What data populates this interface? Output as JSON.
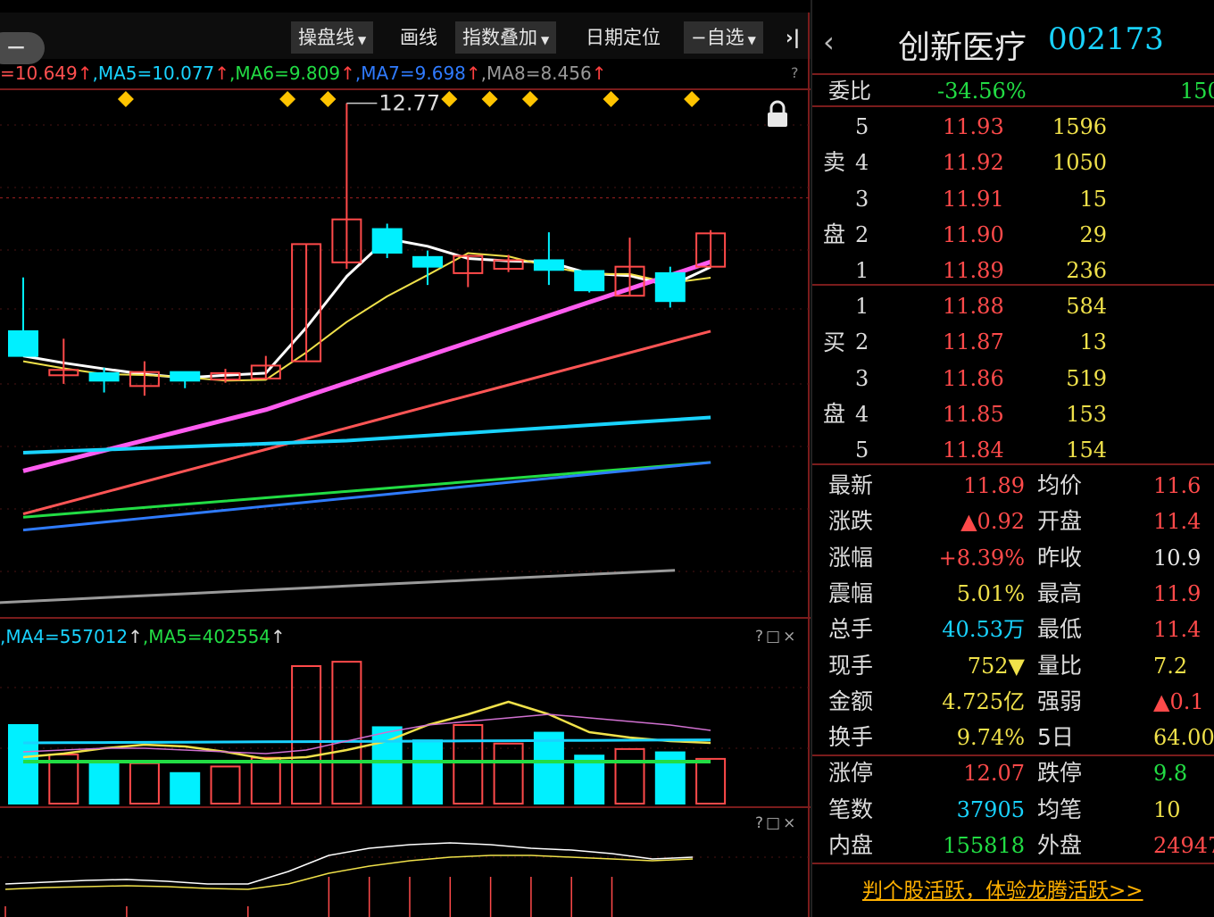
{
  "toolbar": {
    "minus": "−",
    "items": [
      {
        "label": "操盘线",
        "dropdown": true
      },
      {
        "label": "画线",
        "dropdown": false
      },
      {
        "label": "指数叠加",
        "dropdown": true
      },
      {
        "label": "日期定位",
        "dropdown": false
      },
      {
        "label": "−自选",
        "dropdown": true
      },
      {
        "label": "›|",
        "dropdown": false
      }
    ]
  },
  "main_chart": {
    "ma_legend": [
      {
        "text": "=10.649",
        "color": "#ff5050"
      },
      {
        "text": ",MA5=10.077",
        "color": "#19d3ff"
      },
      {
        "text": ",MA6=9.809",
        "color": "#22dd44"
      },
      {
        "text": ",MA7=9.698",
        "color": "#2f7bff"
      },
      {
        "text": ",MA8=8.456",
        "color": "#999999"
      }
    ],
    "high_label": "12.77",
    "help": "?"
  },
  "volume_pane": {
    "legend": [
      {
        "text": ",MA4=557012",
        "color": "#19d3ff"
      },
      {
        "text": ",MA5=402554",
        "color": "#22dd44"
      }
    ],
    "controls": "?□×"
  },
  "indicator_pane": {
    "controls": "?□×"
  },
  "chart_data": {
    "type": "candlestick",
    "candles": [
      {
        "open": 10.65,
        "close": 10.42,
        "high": 11.15,
        "low": 10.42
      },
      {
        "open": 10.24,
        "close": 10.29,
        "high": 10.58,
        "low": 10.16
      },
      {
        "open": 10.26,
        "close": 10.19,
        "high": 10.31,
        "low": 10.08
      },
      {
        "open": 10.14,
        "close": 10.27,
        "high": 10.37,
        "low": 10.05
      },
      {
        "open": 10.27,
        "close": 10.19,
        "high": 10.27,
        "low": 10.12
      },
      {
        "open": 10.2,
        "close": 10.26,
        "high": 10.3,
        "low": 10.17
      },
      {
        "open": 10.21,
        "close": 10.33,
        "high": 10.42,
        "low": 10.2
      },
      {
        "open": 10.37,
        "close": 11.46,
        "high": 11.46,
        "low": 10.37
      },
      {
        "open": 11.29,
        "close": 11.69,
        "high": 12.77,
        "low": 11.23
      },
      {
        "open": 11.6,
        "close": 11.38,
        "high": 11.65,
        "low": 11.33
      },
      {
        "open": 11.34,
        "close": 11.25,
        "high": 11.4,
        "low": 11.08
      },
      {
        "open": 11.19,
        "close": 11.35,
        "high": 11.35,
        "low": 11.06
      },
      {
        "open": 11.23,
        "close": 11.31,
        "high": 11.36,
        "low": 11.2
      },
      {
        "open": 11.31,
        "close": 11.22,
        "high": 11.57,
        "low": 11.08
      },
      {
        "open": 11.21,
        "close": 11.03,
        "high": 11.21,
        "low": 11.01
      },
      {
        "open": 10.98,
        "close": 11.25,
        "high": 11.52,
        "low": 10.98
      },
      {
        "open": 11.19,
        "close": 10.93,
        "high": 11.25,
        "low": 10.87
      },
      {
        "open": 11.25,
        "close": 11.56,
        "high": 11.59,
        "low": 11.25
      }
    ],
    "current_price": 11.89,
    "ylim": [
      8.0,
      12.9
    ],
    "volumes": [
      {
        "value": 720000,
        "dir": "down"
      },
      {
        "value": 450000,
        "dir": "up"
      },
      {
        "value": 390000,
        "dir": "down"
      },
      {
        "value": 370000,
        "dir": "up"
      },
      {
        "value": 280000,
        "dir": "down"
      },
      {
        "value": 340000,
        "dir": "up"
      },
      {
        "value": 420000,
        "dir": "up"
      },
      {
        "value": 1260000,
        "dir": "up"
      },
      {
        "value": 1300000,
        "dir": "up"
      },
      {
        "value": 700000,
        "dir": "down"
      },
      {
        "value": 580000,
        "dir": "down"
      },
      {
        "value": 720000,
        "dir": "up"
      },
      {
        "value": 550000,
        "dir": "up"
      },
      {
        "value": 650000,
        "dir": "down"
      },
      {
        "value": 440000,
        "dir": "down"
      },
      {
        "value": 500000,
        "dir": "up"
      },
      {
        "value": 470000,
        "dir": "down"
      },
      {
        "value": 410000,
        "dir": "up"
      }
    ],
    "volume_max": 1350000
  },
  "quote": {
    "back": "‹",
    "name": "创新医疗",
    "code": "002173",
    "weibi": {
      "label": "委比",
      "value": "-34.56%",
      "extra": "150"
    },
    "sell_side_label": [
      "卖",
      "盘"
    ],
    "buy_side_label": [
      "买",
      "盘"
    ],
    "sell": [
      {
        "level": "5",
        "price": "11.93",
        "vol": "1596"
      },
      {
        "level": "4",
        "price": "11.92",
        "vol": "1050"
      },
      {
        "level": "3",
        "price": "11.91",
        "vol": "15"
      },
      {
        "level": "2",
        "price": "11.90",
        "vol": "29"
      },
      {
        "level": "1",
        "price": "11.89",
        "vol": "236"
      }
    ],
    "buy": [
      {
        "level": "1",
        "price": "11.88",
        "vol": "584"
      },
      {
        "level": "2",
        "price": "11.87",
        "vol": "13"
      },
      {
        "level": "3",
        "price": "11.86",
        "vol": "519"
      },
      {
        "level": "4",
        "price": "11.85",
        "vol": "153"
      },
      {
        "level": "5",
        "price": "11.84",
        "vol": "154"
      }
    ],
    "stats": [
      {
        "l1": "最新",
        "v1": "11.89",
        "c1": "red",
        "l2": "均价",
        "v2": "11.6",
        "c2": "red"
      },
      {
        "l1": "涨跌",
        "v1": "▲0.92",
        "c1": "red",
        "l2": "开盘",
        "v2": "11.4",
        "c2": "red"
      },
      {
        "l1": "涨幅",
        "v1": "+8.39%",
        "c1": "red",
        "l2": "昨收",
        "v2": "10.9",
        "c2": "white"
      },
      {
        "l1": "震幅",
        "v1": "5.01%",
        "c1": "yellow",
        "l2": "最高",
        "v2": "11.9",
        "c2": "red"
      },
      {
        "l1": "总手",
        "v1": "40.53万",
        "c1": "cyan",
        "l2": "最低",
        "v2": "11.4",
        "c2": "red"
      },
      {
        "l1": "现手",
        "v1": "752▼",
        "c1": "yellow",
        "l2": "量比",
        "v2": "7.2",
        "c2": "yellow"
      },
      {
        "l1": "金额",
        "v1": "4.725亿",
        "c1": "yellow",
        "l2": "强弱",
        "v2": "▲0.1",
        "c2": "red"
      },
      {
        "l1": "换手",
        "v1": "9.74%",
        "c1": "yellow",
        "l2": "5日",
        "v2": "64.00",
        "c2": "yellow"
      },
      {
        "l1": "涨停",
        "v1": "12.07",
        "c1": "red",
        "l2": "跌停",
        "v2": "9.8",
        "c2": "green"
      },
      {
        "l1": "笔数",
        "v1": "37905",
        "c1": "cyan",
        "l2": "均笔",
        "v2": "10",
        "c2": "yellow"
      },
      {
        "l1": "内盘",
        "v1": "155818",
        "c1": "green",
        "l2": "外盘",
        "v2": "24947",
        "c2": "red"
      }
    ],
    "promo": "判个股活跃，体验龙腾活跃>>"
  },
  "colors": {
    "up": "#ff4a4a",
    "down": "#00f0ff",
    "border": "#7a1c1c"
  }
}
